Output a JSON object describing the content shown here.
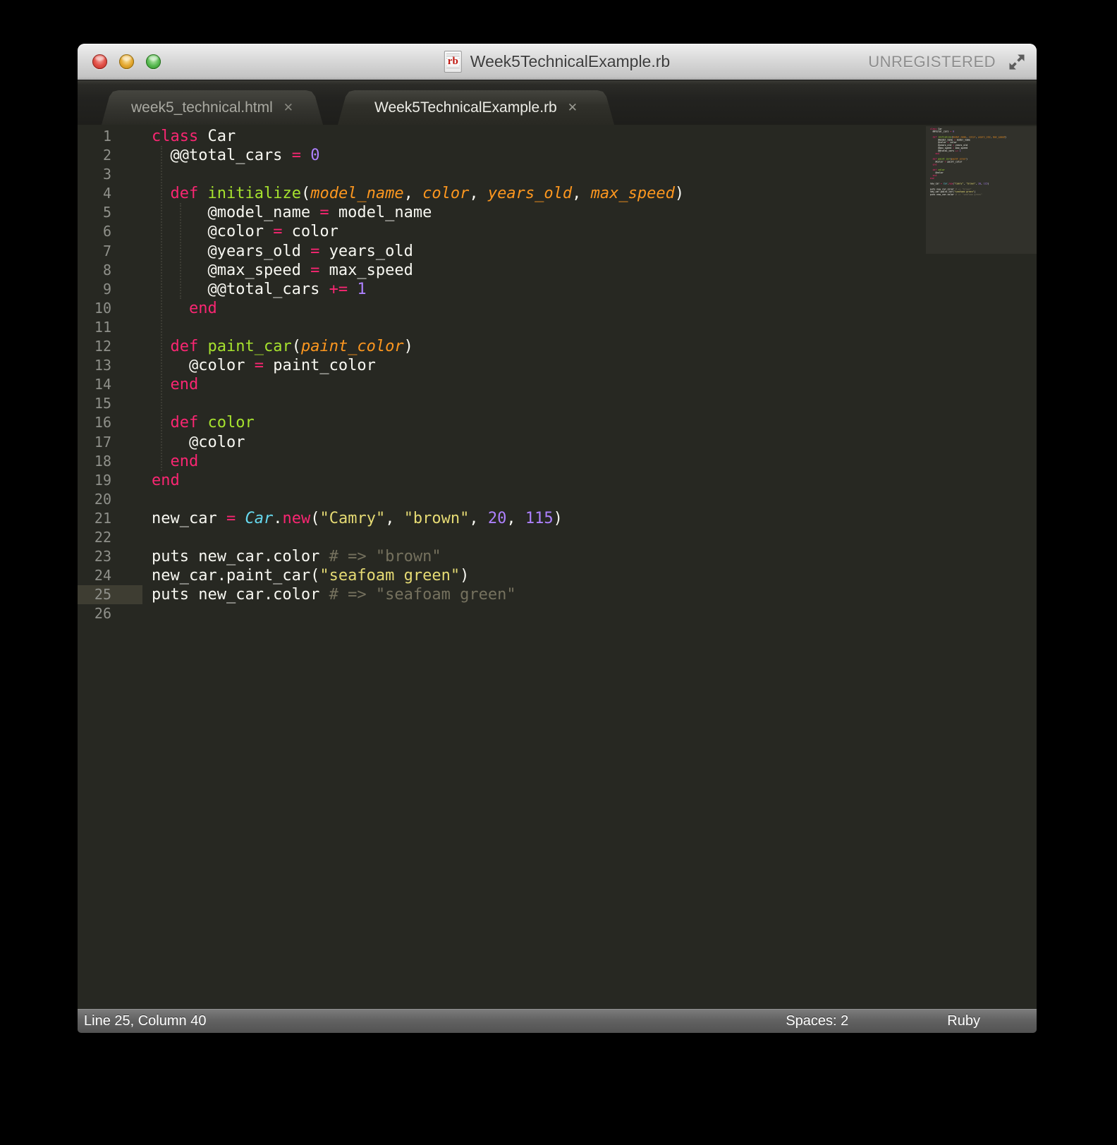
{
  "window": {
    "title": "Week5TechnicalExample.rb",
    "registration_status": "UNREGISTERED",
    "file_icon_label": "rb"
  },
  "tab_bar": {
    "tabs": [
      {
        "label": "week5_technical.html",
        "active": false,
        "close_glyph": "✕"
      },
      {
        "label": "Week5TechnicalExample.rb",
        "active": true,
        "close_glyph": "✕"
      }
    ]
  },
  "editor": {
    "syntax": "Ruby",
    "active_line": 25,
    "line_count": 26,
    "token_classes": {
      "k": "keyword",
      "e": "method-name",
      "a": "parameter",
      "n": "number",
      "s": "string",
      "c": "class-name",
      "m": "comment",
      "p": "plain"
    },
    "indent_guides": [
      {
        "ch": 2,
        "from_line": 2,
        "to_line": 18
      },
      {
        "ch": 4,
        "from_line": 5,
        "to_line": 9
      }
    ],
    "lines": [
      {
        "n": 1,
        "tokens": [
          [
            "class",
            "k"
          ],
          [
            " Car",
            "p"
          ]
        ]
      },
      {
        "n": 2,
        "tokens": [
          [
            "  @@total_cars ",
            "p"
          ],
          [
            "=",
            "k"
          ],
          [
            " ",
            "p"
          ],
          [
            "0",
            "n"
          ]
        ]
      },
      {
        "n": 3,
        "tokens": []
      },
      {
        "n": 4,
        "tokens": [
          [
            "  ",
            "p"
          ],
          [
            "def",
            "k"
          ],
          [
            " ",
            "p"
          ],
          [
            "initialize",
            "e"
          ],
          [
            "(",
            "p"
          ],
          [
            "model_name",
            "a"
          ],
          [
            ", ",
            "p"
          ],
          [
            "color",
            "a"
          ],
          [
            ", ",
            "p"
          ],
          [
            "years_old",
            "a"
          ],
          [
            ", ",
            "p"
          ],
          [
            "max_speed",
            "a"
          ],
          [
            ")",
            "p"
          ]
        ]
      },
      {
        "n": 5,
        "tokens": [
          [
            "      @model_name ",
            "p"
          ],
          [
            "=",
            "k"
          ],
          [
            " model_name",
            "p"
          ]
        ]
      },
      {
        "n": 6,
        "tokens": [
          [
            "      @color ",
            "p"
          ],
          [
            "=",
            "k"
          ],
          [
            " color",
            "p"
          ]
        ]
      },
      {
        "n": 7,
        "tokens": [
          [
            "      @years_old ",
            "p"
          ],
          [
            "=",
            "k"
          ],
          [
            " years_old",
            "p"
          ]
        ]
      },
      {
        "n": 8,
        "tokens": [
          [
            "      @max_speed ",
            "p"
          ],
          [
            "=",
            "k"
          ],
          [
            " max_speed",
            "p"
          ]
        ]
      },
      {
        "n": 9,
        "tokens": [
          [
            "      @@total_cars ",
            "p"
          ],
          [
            "+=",
            "k"
          ],
          [
            " ",
            "p"
          ],
          [
            "1",
            "n"
          ]
        ]
      },
      {
        "n": 10,
        "tokens": [
          [
            "    ",
            "p"
          ],
          [
            "end",
            "k"
          ]
        ]
      },
      {
        "n": 11,
        "tokens": []
      },
      {
        "n": 12,
        "tokens": [
          [
            "  ",
            "p"
          ],
          [
            "def",
            "k"
          ],
          [
            " ",
            "p"
          ],
          [
            "paint_car",
            "e"
          ],
          [
            "(",
            "p"
          ],
          [
            "paint_color",
            "a"
          ],
          [
            ")",
            "p"
          ]
        ]
      },
      {
        "n": 13,
        "tokens": [
          [
            "    @color ",
            "p"
          ],
          [
            "=",
            "k"
          ],
          [
            " paint_color",
            "p"
          ]
        ]
      },
      {
        "n": 14,
        "tokens": [
          [
            "  ",
            "p"
          ],
          [
            "end",
            "k"
          ]
        ]
      },
      {
        "n": 15,
        "tokens": []
      },
      {
        "n": 16,
        "tokens": [
          [
            "  ",
            "p"
          ],
          [
            "def",
            "k"
          ],
          [
            " ",
            "p"
          ],
          [
            "color",
            "e"
          ]
        ]
      },
      {
        "n": 17,
        "tokens": [
          [
            "    @color",
            "p"
          ]
        ]
      },
      {
        "n": 18,
        "tokens": [
          [
            "  ",
            "p"
          ],
          [
            "end",
            "k"
          ]
        ]
      },
      {
        "n": 19,
        "tokens": [
          [
            "end",
            "k"
          ]
        ]
      },
      {
        "n": 20,
        "tokens": []
      },
      {
        "n": 21,
        "tokens": [
          [
            "new_car ",
            "p"
          ],
          [
            "=",
            "k"
          ],
          [
            " ",
            "p"
          ],
          [
            "Car",
            "c"
          ],
          [
            ".",
            "p"
          ],
          [
            "new",
            "k"
          ],
          [
            "(",
            "p"
          ],
          [
            "\"Camry\"",
            "s"
          ],
          [
            ", ",
            "p"
          ],
          [
            "\"brown\"",
            "s"
          ],
          [
            ", ",
            "p"
          ],
          [
            "20",
            "n"
          ],
          [
            ", ",
            "p"
          ],
          [
            "115",
            "n"
          ],
          [
            ")",
            "p"
          ]
        ]
      },
      {
        "n": 22,
        "tokens": []
      },
      {
        "n": 23,
        "tokens": [
          [
            "puts new_car.color ",
            "p"
          ],
          [
            "# => \"brown\"",
            "m"
          ]
        ]
      },
      {
        "n": 24,
        "tokens": [
          [
            "new_car.paint_car(",
            "p"
          ],
          [
            "\"seafoam green\"",
            "s"
          ],
          [
            ")",
            "p"
          ]
        ]
      },
      {
        "n": 25,
        "tokens": [
          [
            "puts new_car.color ",
            "p"
          ],
          [
            "# => \"seafoam green\"",
            "m"
          ]
        ]
      },
      {
        "n": 26,
        "tokens": []
      }
    ]
  },
  "status_bar": {
    "position": "Line 25, Column 40",
    "indent": "Spaces: 2",
    "syntax": "Ruby"
  },
  "colors": {
    "editor_background": "#272822",
    "gutter_foreground": "#8f908a",
    "active_line_gutter": "#3e3d32",
    "token_keyword": "#f92672",
    "token_method": "#a6e22e",
    "token_parameter": "#fd971f",
    "token_number": "#ae81ff",
    "token_string": "#e6db74",
    "token_class": "#66d9ef",
    "token_comment": "#75715e",
    "token_plain": "#f8f8f2"
  }
}
